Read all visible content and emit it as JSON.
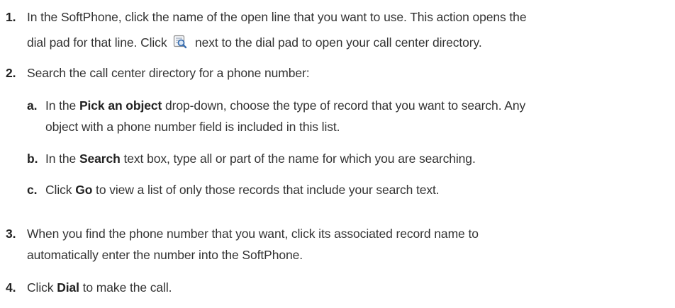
{
  "steps": [
    {
      "number": "1.",
      "line1": "In the SoftPhone, click the name of the open line that you want to use. This action opens the",
      "line2_before_icon": "dial pad for that line. Click",
      "icon": "directory-search-icon",
      "line2_after_icon": "next to the dial pad to open your call center directory."
    },
    {
      "number": "2.",
      "text": "Search the call center directory for a phone number:",
      "substeps": [
        {
          "letter": "a.",
          "pre": "In the ",
          "bold": "Pick an object",
          "post_line1": " drop-down, choose the type of record that you want to search. Any",
          "line2": "object with a phone number field is included in this list."
        },
        {
          "letter": "b.",
          "pre": "In the ",
          "bold": "Search",
          "post": " text box, type all or part of the name for which you are searching."
        },
        {
          "letter": "c.",
          "pre": "Click ",
          "bold": "Go",
          "post": " to view a list of only those records that include your search text."
        }
      ]
    },
    {
      "number": "3.",
      "line1": "When you find the phone number that you want, click its associated record name to",
      "line2": "automatically enter the number into the SoftPhone."
    },
    {
      "number": "4.",
      "pre": "Click ",
      "bold": "Dial",
      "post": " to make the call."
    }
  ],
  "colors": {
    "text": "#333333",
    "strong": "#222222",
    "icon_blue": "#3a6fb0",
    "icon_gray": "#8a8a8a"
  }
}
